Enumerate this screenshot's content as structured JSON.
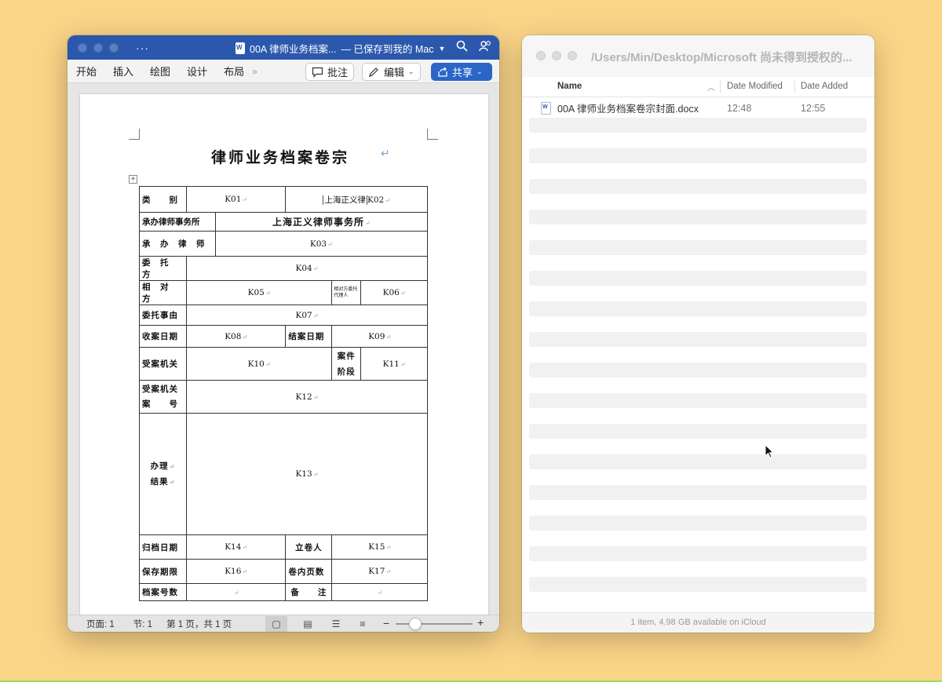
{
  "word": {
    "doc_name": "00A 律师业务档案...",
    "save_status": "— 已保存到我的 Mac",
    "tabs": [
      "开始",
      "插入",
      "绘图",
      "设计",
      "布局"
    ],
    "comment_label": "批注",
    "edit_label": "编辑",
    "share_label": "共享",
    "document": {
      "title": "律师业务档案卷宗",
      "rows": {
        "r1": {
          "l1": "类　　别",
          "v1": "K01",
          "v2a": "上海正义律",
          "v2b": "K02"
        },
        "r2": {
          "l1": "承办律师事务所",
          "v1": "上海正义律师事务所"
        },
        "r3": {
          "l1": "承　办　律　师",
          "v1": "K03"
        },
        "r4": {
          "l1": "委　托　方",
          "v1": "K04"
        },
        "r5": {
          "l1": "相　对　方",
          "v1": "K05",
          "l2": "相对方委托代理人",
          "v2": "K06"
        },
        "r6": {
          "l1": "委托事由",
          "v1": "K07"
        },
        "r7": {
          "l1": "收案日期",
          "v1": "K08",
          "l2": "结案日期",
          "v2": "K09"
        },
        "r8": {
          "l1": "受案机关",
          "v1": "K10",
          "l2a": "案件",
          "l2b": "阶段",
          "v2": "K11"
        },
        "r9": {
          "l1a": "受案机关",
          "l1b": "案　　号",
          "v1": "K12"
        },
        "r10": {
          "l1a": "办理",
          "l1b": "结果",
          "v1": "K13"
        },
        "r11": {
          "l1": "归档日期",
          "v1": "K14",
          "l2": "立卷人",
          "v2": "K15"
        },
        "r12": {
          "l1": "保存期限",
          "v1": "K16",
          "l2": "卷内页数",
          "v2": "K17"
        },
        "r13": {
          "l1": "档案号数",
          "l2": "备　　注"
        }
      }
    },
    "status": {
      "page": "页面: 1",
      "section": "节: 1",
      "pages": "第 1 页，共 1 页"
    },
    "zoom_percent": 55
  },
  "finder": {
    "path": "/Users/Min/Desktop/Microsoft 尚未得到授权的...",
    "columns": {
      "name": "Name",
      "modified": "Date Modified",
      "added": "Date Added"
    },
    "files": [
      {
        "name": "00A 律师业务档案卷宗封面.docx",
        "modified": "12:48",
        "added": "12:55"
      }
    ],
    "status": "1 item, 4.98 GB available on iCloud"
  }
}
